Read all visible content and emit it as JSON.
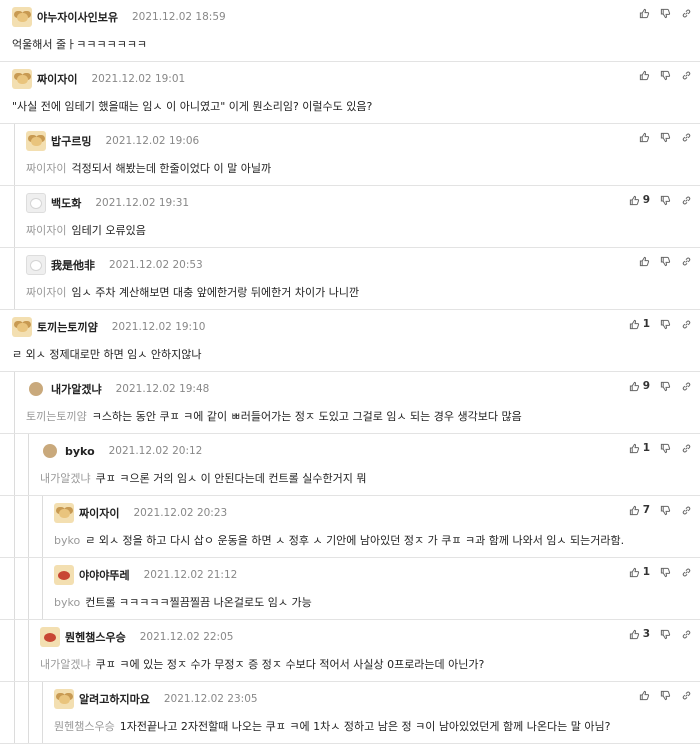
{
  "comments": [
    {
      "level": 0,
      "avatar": "dog",
      "nick": "야누자이사인보유",
      "date": "2021.12.02 18:59",
      "reply_to": "",
      "text": "억울해서 줄ㅏㅋㅋㅋㅋㅋㅋㅋ",
      "likes": ""
    },
    {
      "level": 0,
      "avatar": "dog",
      "nick": "짜이자이",
      "date": "2021.12.02 19:01",
      "reply_to": "",
      "text": "\"사실 전에 임테기 했을때는 임ㅅ 이 아니였고\" 이게 뭔소리임? 이럴수도 있음?",
      "likes": ""
    },
    {
      "level": 1,
      "avatar": "dog",
      "nick": "밥구르밍",
      "date": "2021.12.02 19:06",
      "reply_to": "짜이자이",
      "text": "걱정되서 해봤는데 한줄이었다 이 말 아닐까",
      "likes": ""
    },
    {
      "level": 1,
      "avatar": "white",
      "nick": "백도화",
      "date": "2021.12.02 19:31",
      "reply_to": "짜이자이",
      "text": "임테기 오류있음",
      "likes": "9"
    },
    {
      "level": 1,
      "avatar": "white",
      "nick": "我是他非",
      "date": "2021.12.02 20:53",
      "reply_to": "짜이자이",
      "text": "임ㅅ 주차 계산해보면 대충 앞에한거랑 뒤에한거 차이가 나니깐",
      "likes": ""
    },
    {
      "level": 0,
      "avatar": "dog",
      "nick": "토끼는토끼얌",
      "date": "2021.12.02 19:10",
      "reply_to": "",
      "text": "ㄹ 외ㅅ 정제대로만 하면 임ㅅ  안하지않나",
      "likes": "1"
    },
    {
      "level": 1,
      "avatar": "circle",
      "nick": "내가알겠냐",
      "date": "2021.12.02 19:48",
      "reply_to": "토끼는토끼얌",
      "text": "ㅋ스하는 동안 쿠ㅍ  ㅋ에 같이 ㅃ러들어가는 정ㅈ 도있고 그걸로 임ㅅ 되는 경우 생각보다 많음",
      "likes": "9"
    },
    {
      "level": 2,
      "avatar": "circle",
      "nick": "byko",
      "date": "2021.12.02 20:12",
      "reply_to": "내가알겠냐",
      "text": "쿠ㅍ  ㅋ으론 거의 임ㅅ 이 안된다는데 컨트롤 실수한거지 뭐",
      "likes": "1"
    },
    {
      "level": 3,
      "avatar": "dog",
      "nick": "짜이자이",
      "date": "2021.12.02 20:23",
      "reply_to": "byko",
      "text": "ㄹ 외ㅅ 정을 하고 다시 삽ㅇ 운동을 하면 ㅅ 정후 ㅅ 기안에 남아있던 정ㅈ 가 쿠ㅍ  ㅋ과 함께 나와서 임ㅅ 되는거라함.",
      "likes": "7"
    },
    {
      "level": 3,
      "avatar": "red",
      "nick": "야야야뚜레",
      "date": "2021.12.02 21:12",
      "reply_to": "byko",
      "text": "컨트롤 ㅋㅋㅋㅋㅋ찔끔찔끔 나온걸로도 임ㅅ  가능",
      "likes": "1"
    },
    {
      "level": 2,
      "avatar": "red",
      "nick": "뭔헨챔스우승",
      "date": "2021.12.02 22:05",
      "reply_to": "내가알겠냐",
      "text": "쿠ㅍ  ㅋ에 있는 정ㅈ 수가 무정ㅈ 증 정ㅈ 수보다 적어서 사실상 0프로라는데 아닌가?",
      "likes": "3"
    },
    {
      "level": 3,
      "avatar": "dog",
      "nick": "알려고하지마요",
      "date": "2021.12.02 23:05",
      "reply_to": "뭔헨챔스우승",
      "text": "1자전끝나고 2자전할때 나오는 쿠ㅍ  ㅋ에 1차ㅅ 정하고 남은 정 ㅋ이 남아있었던게 함께 나온다는 말 아님?",
      "likes": ""
    }
  ]
}
